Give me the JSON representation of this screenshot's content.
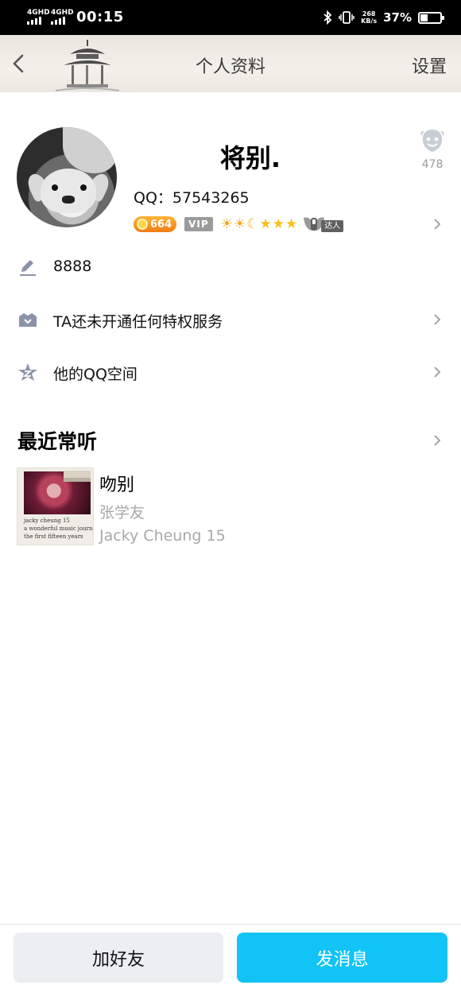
{
  "status_bar": {
    "net1": "4GHD",
    "net2": "4GHD",
    "time": "00:15",
    "speed_value": "268",
    "speed_unit": "KB/s",
    "battery_percent": "37%",
    "battery_level": 0.37,
    "icons": [
      "signal-icon",
      "signal-icon",
      "bluetooth-icon",
      "vibrate-icon",
      "battery-icon"
    ]
  },
  "nav": {
    "title": "个人资料",
    "settings_label": "设置"
  },
  "profile": {
    "name": "将别.",
    "qq_label": "QQ：57543265",
    "like_count": "478",
    "level_number": "664",
    "vip_label": "VIP",
    "level_icons": [
      "☀",
      "☀",
      "☾",
      "★",
      "★",
      "★"
    ],
    "talent_label": "达人"
  },
  "rows": {
    "signature": "8888",
    "privilege": "TA还未开通任何特权服务",
    "qzone": "他的QQ空间"
  },
  "music": {
    "section_title": "最近常听",
    "song_title": "吻别",
    "artist": "张学友",
    "album": "Jacky Cheung 15",
    "cover_lines": [
      "jacky cheung 15",
      "a wonderful music journey",
      "the first fifteen years"
    ]
  },
  "actions": {
    "add_friend": "加好友",
    "send_message": "发消息"
  },
  "colors": {
    "primary_button": "#12c4f5",
    "secondary_button": "#eceef2",
    "muted_text": "#a8a8a8"
  }
}
